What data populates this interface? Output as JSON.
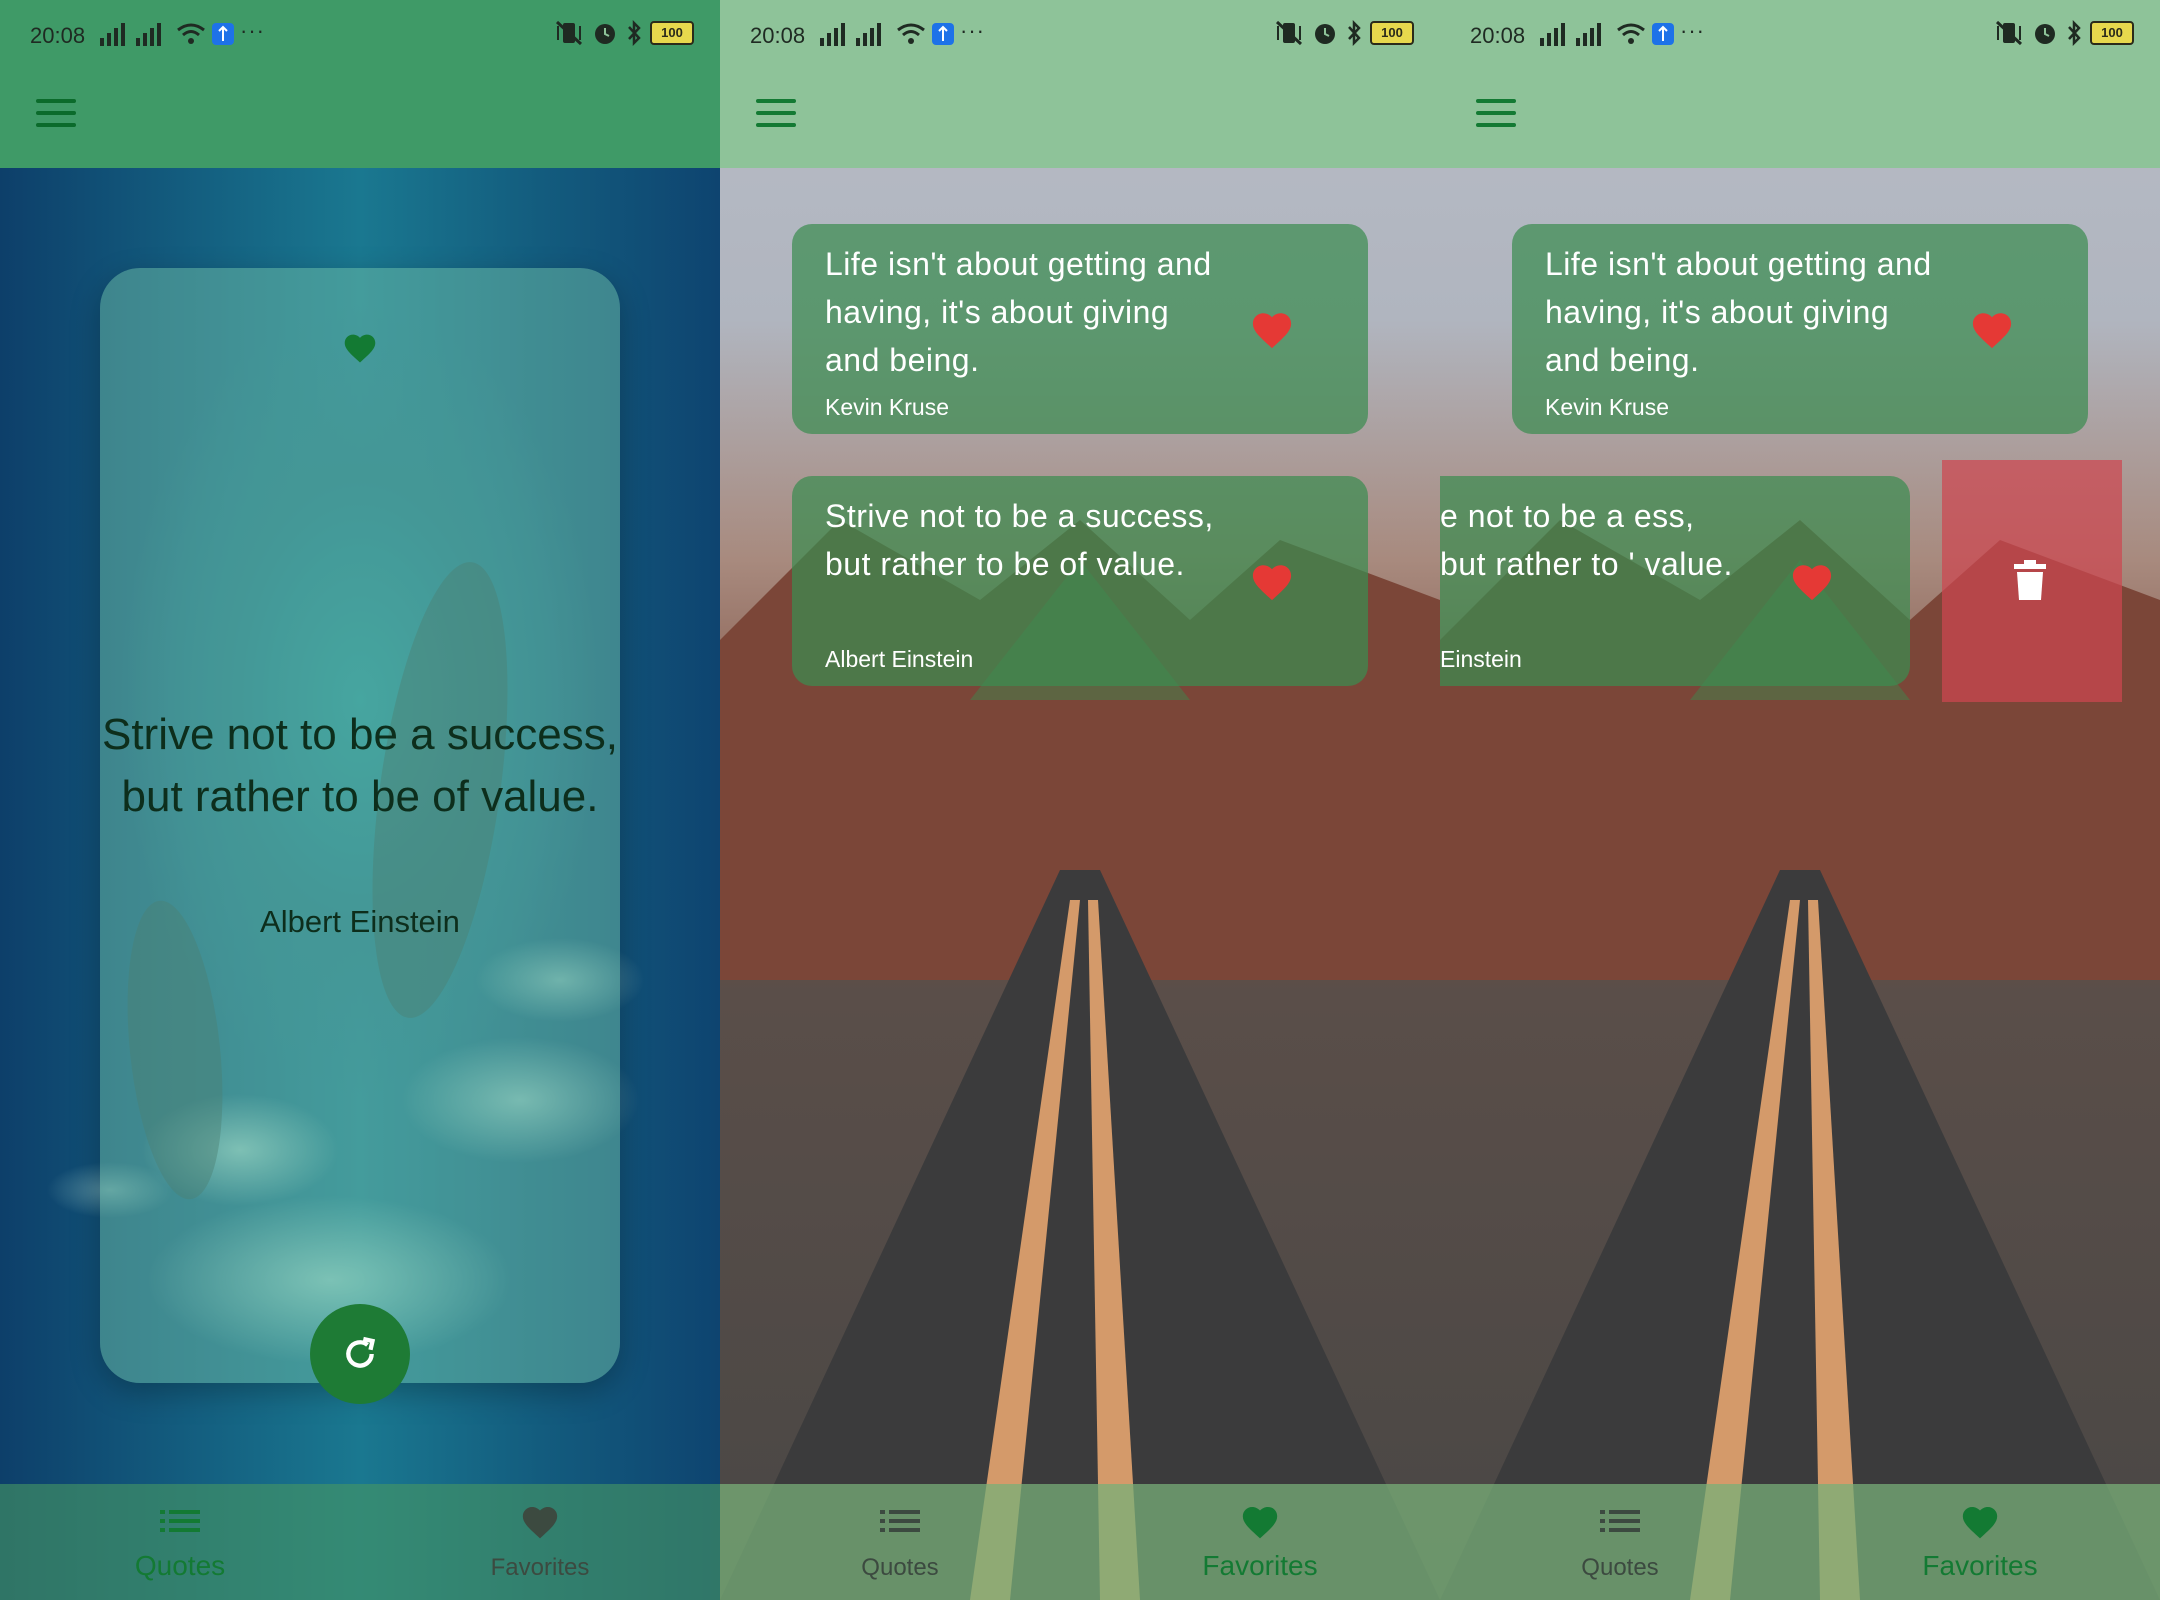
{
  "status": {
    "time": "20:08",
    "battery": "100",
    "more": "···"
  },
  "quote": {
    "text": "Strive not to be a success, but rather to be of value.",
    "author": "Albert Einstein"
  },
  "favorites": [
    {
      "text": "Life isn't about getting and having, it's about giving and being.",
      "author": "Kevin Kruse"
    },
    {
      "text": "Strive not to be a success, but rather to be of value.",
      "author": "Albert Einstein"
    }
  ],
  "swiped_card": {
    "text": "e not to be a ess, but rather to ' value.",
    "author": "Einstein"
  },
  "nav": {
    "quotes_label": "Quotes",
    "favorites_label": "Favorites"
  },
  "colors": {
    "accent_green": "#137a33",
    "heart_red": "#e53935",
    "delete_red": "#cd4650"
  }
}
